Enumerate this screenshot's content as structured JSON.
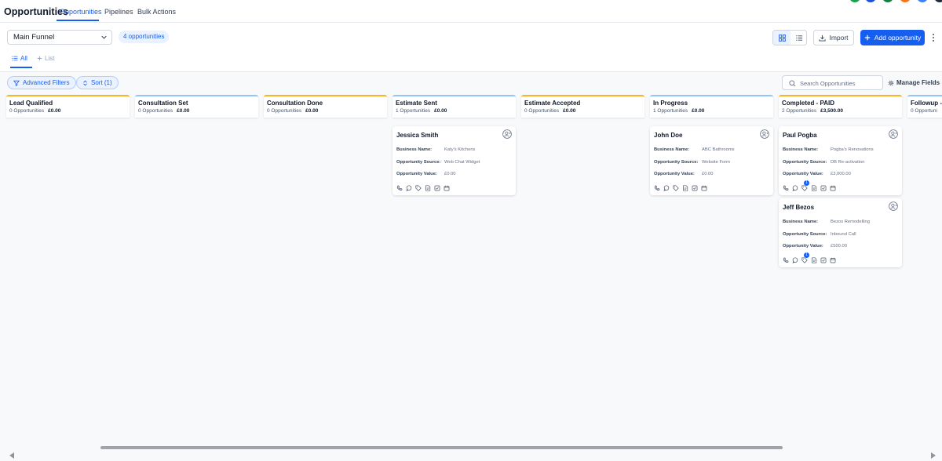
{
  "header": {
    "title": "Opportunities",
    "tabs": [
      {
        "label": "Opportunities",
        "active": true
      },
      {
        "label": "Pipelines",
        "active": false
      },
      {
        "label": "Bulk Actions",
        "active": false
      }
    ]
  },
  "toolbar": {
    "pipeline_value": "Main Funnel",
    "count_label": "4 opportunities",
    "import_label": "Import",
    "add_label": "Add opportunity"
  },
  "subtabs": {
    "all_label": "All",
    "list_label": "List"
  },
  "filters": {
    "advanced_label": "Advanced Filters",
    "sort_label": "Sort (1)",
    "search_placeholder": "Search Opportunities",
    "manage_fields_label": "Manage Fields"
  },
  "colors": {
    "accent": "#155eef",
    "stage_border": "#fdb022"
  },
  "card_labels": {
    "business": "Business Name:",
    "source": "Opportunity Source:",
    "value": "Opportunity Value:"
  },
  "stages": [
    {
      "title": "Lead Qualified",
      "count": "0 Opportunities",
      "amount": "£0.00"
    },
    {
      "title": "Consultation Set",
      "count": "0 Opportunities",
      "amount": "£0.00"
    },
    {
      "title": "Consultation Done",
      "count": "0 Opportunities",
      "amount": "£0.00"
    },
    {
      "title": "Estimate Sent",
      "count": "1 Opportunities",
      "amount": "£0.00",
      "cards": [
        {
          "name": "Jessica Smith",
          "business": "Katy's Kitchens",
          "source": "Web Chat Widget",
          "value": "£0.00",
          "badge": ""
        }
      ]
    },
    {
      "title": "Estimate Accepted",
      "count": "0 Opportunities",
      "amount": "£0.00"
    },
    {
      "title": "In Progress",
      "count": "1 Opportunities",
      "amount": "£0.00",
      "cards": [
        {
          "name": "John Doe",
          "business": "ABC Bathrooms",
          "source": "Website Form",
          "value": "£0.00",
          "badge": ""
        }
      ]
    },
    {
      "title": "Completed - PAID",
      "count": "2 Opportunities",
      "amount": "£3,500.00",
      "cards": [
        {
          "name": "Paul Pogba",
          "business": "Pogba's Renovations",
          "source": "DB Re-activation",
          "value": "£3,000.00",
          "badge": "1"
        },
        {
          "name": "Jeff Bezos",
          "business": "Bezos Remodelling",
          "source": "Inbound Call",
          "value": "£500.00",
          "badge": "1"
        }
      ]
    },
    {
      "title": "Followup - ",
      "count": "0 Opportuni",
      "amount": ""
    }
  ]
}
